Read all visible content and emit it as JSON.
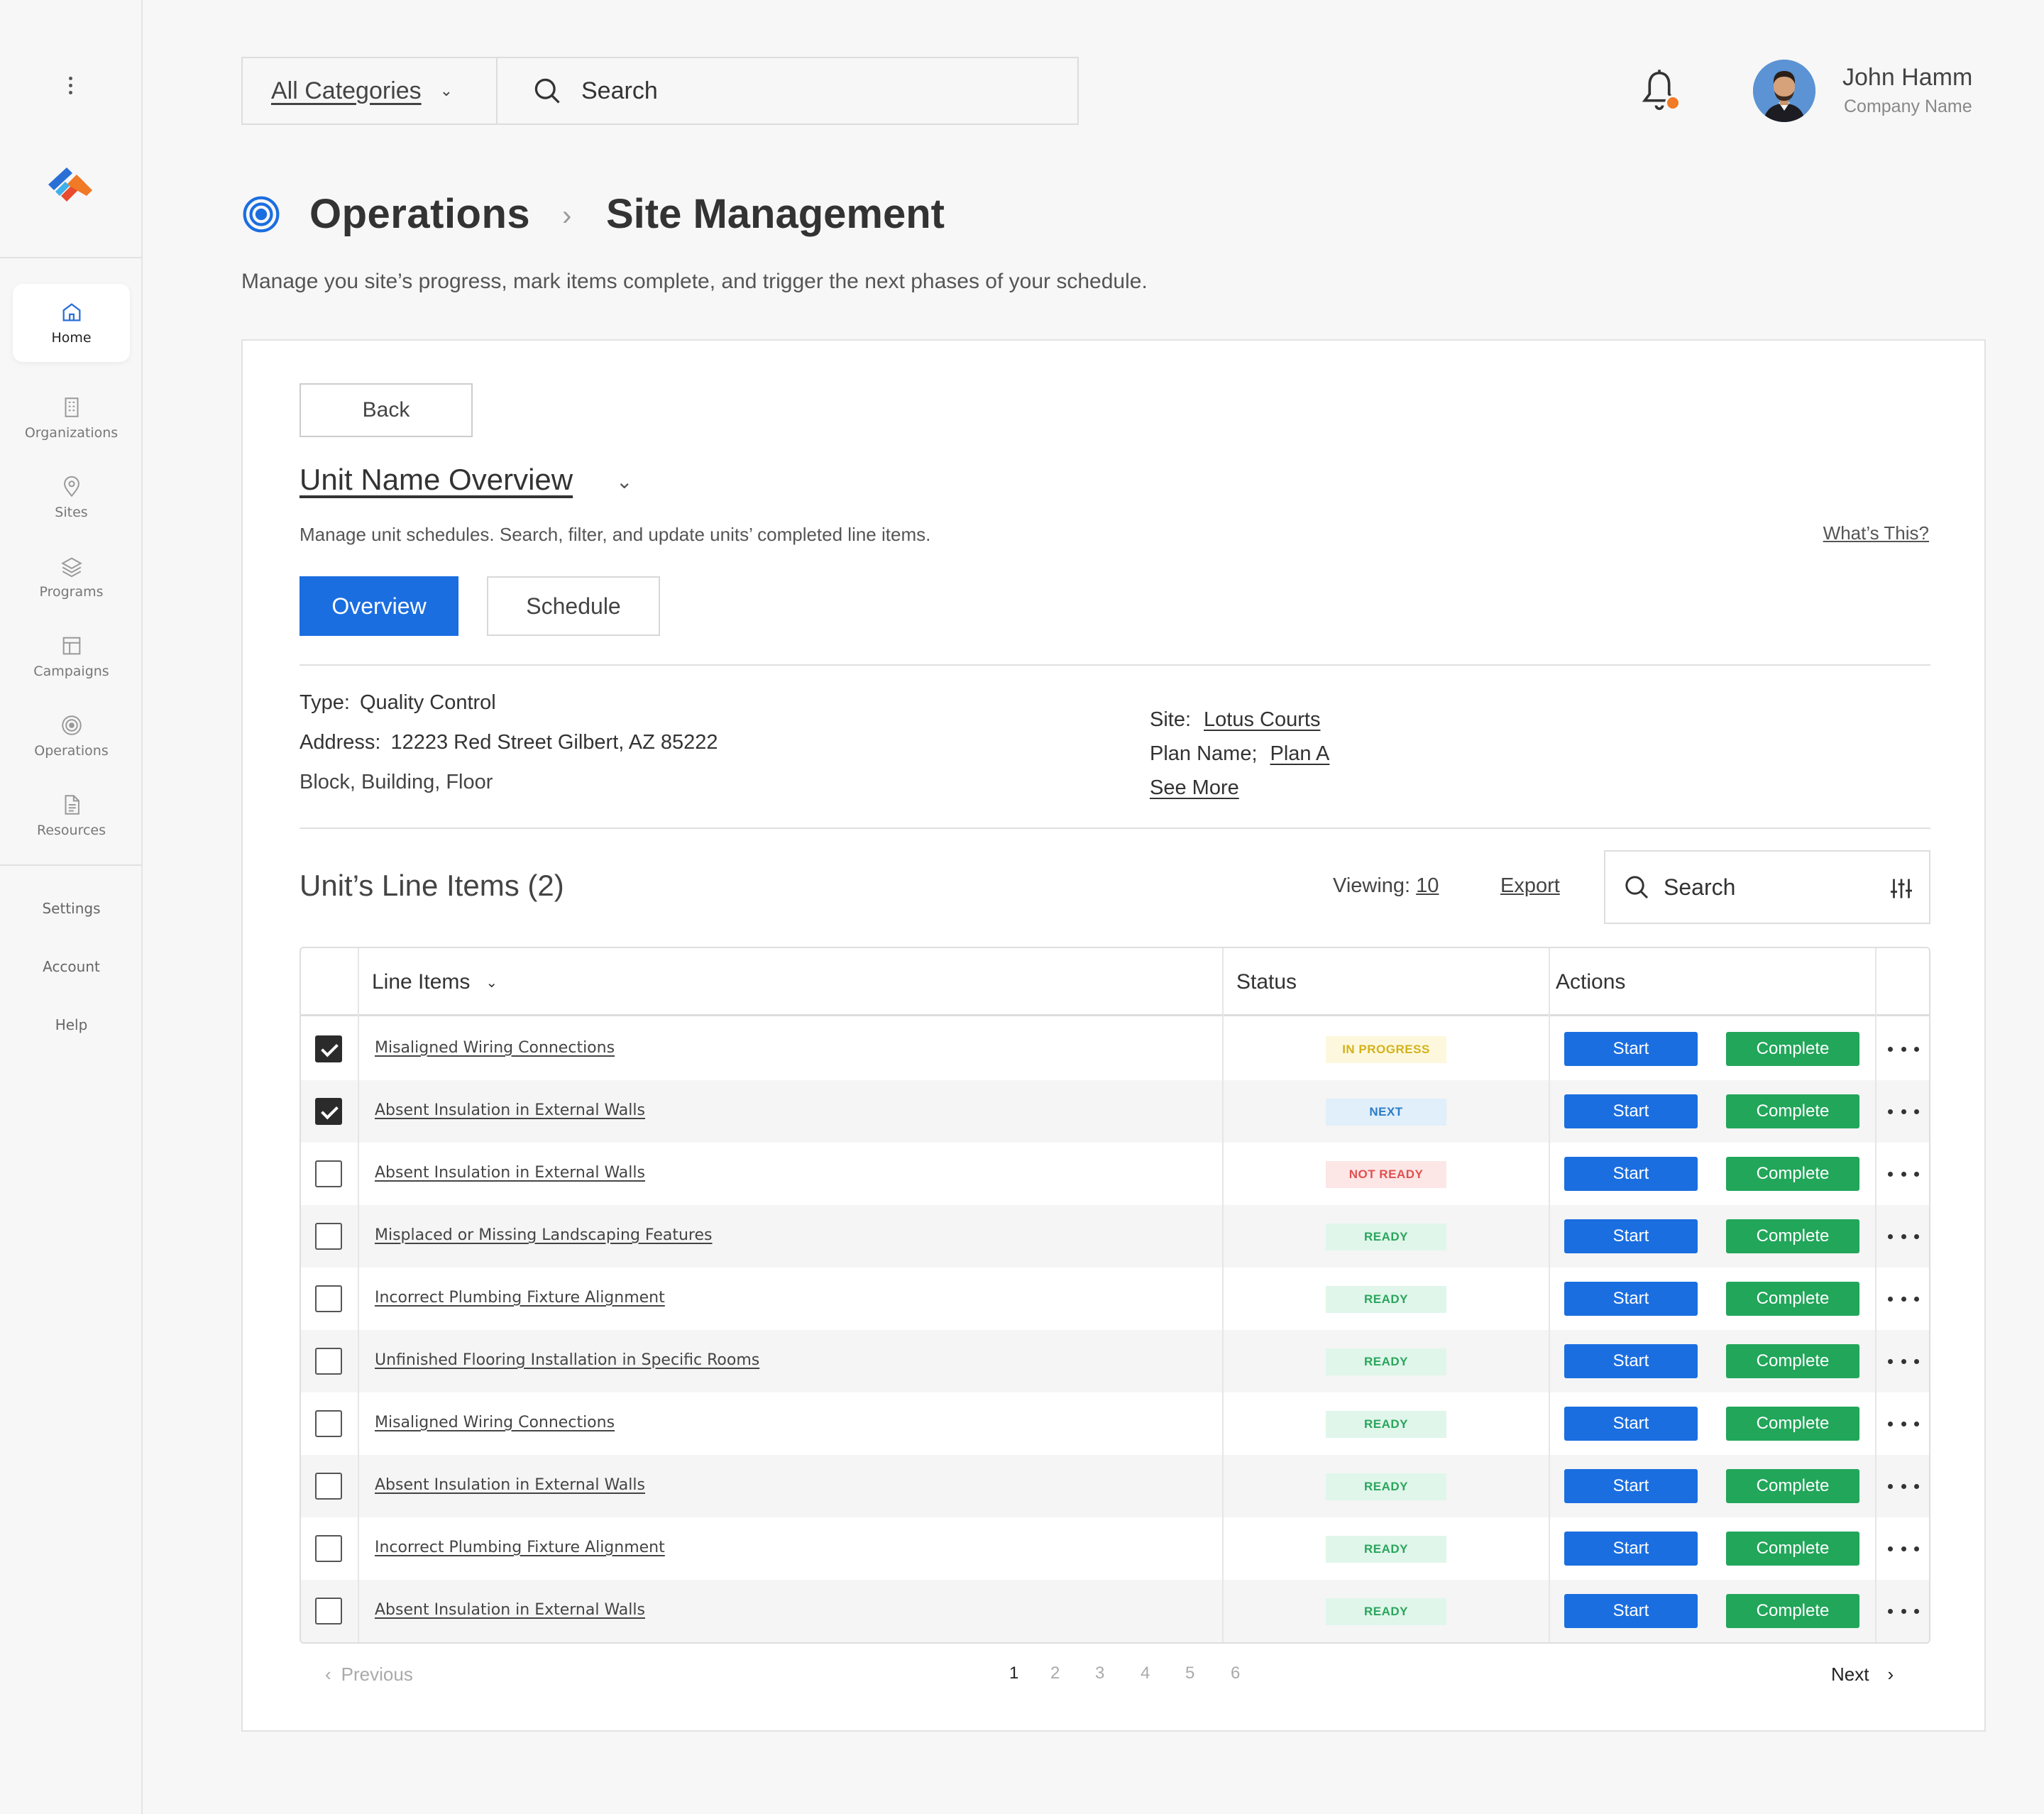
{
  "search_bar": {
    "category_label": "All Categories",
    "placeholder": "Search"
  },
  "user": {
    "name": "John Hamm",
    "company": "Company Name"
  },
  "sidebar": {
    "items": [
      {
        "label": "Home",
        "icon": "home-icon"
      },
      {
        "label": "Organizations",
        "icon": "building-icon"
      },
      {
        "label": "Sites",
        "icon": "location-pin-icon"
      },
      {
        "label": "Programs",
        "icon": "layers-icon"
      },
      {
        "label": "Campaigns",
        "icon": "layout-icon"
      },
      {
        "label": "Operations",
        "icon": "target-icon"
      },
      {
        "label": "Resources",
        "icon": "document-icon"
      }
    ],
    "links": [
      "Settings",
      "Account",
      "Help"
    ]
  },
  "breadcrumb": {
    "section": "Operations",
    "page": "Site Management",
    "separator": "›"
  },
  "page_description": "Manage you site’s progress, mark items complete, and trigger the next phases of your schedule.",
  "card": {
    "back_label": "Back",
    "unit_title": "Unit Name Overview",
    "unit_description": "Manage unit schedules. Search, filter, and update units’ completed line items.",
    "whats_this": "What’s This?",
    "tabs": {
      "overview": "Overview",
      "schedule": "Schedule"
    },
    "details": {
      "type_label": "Type:",
      "type_value": "Quality Control",
      "address_label": "Address:",
      "address_value": "12223 Red Street Gilbert, AZ 85222",
      "location_text": "Block, Building, Floor",
      "site_label": "Site:",
      "site_value": "Lotus Courts",
      "plan_label": "Plan Name;",
      "plan_value": "Plan A",
      "see_more": "See More"
    },
    "line_items_title": "Unit’s Line Items (2)",
    "viewing_label": "Viewing:",
    "viewing_value": "10",
    "export_label": "Export",
    "table_search_placeholder": "Search"
  },
  "table": {
    "headers": {
      "items": "Line Items",
      "status": "Status",
      "actions": "Actions"
    },
    "start_label": "Start",
    "complete_label": "Complete",
    "rows": [
      {
        "name": "Misaligned Wiring Connections",
        "status": "IN PROGRESS",
        "status_key": "progress",
        "checked": true
      },
      {
        "name": "Absent Insulation in External Walls",
        "status": "NEXT",
        "status_key": "next",
        "checked": true
      },
      {
        "name": "Absent Insulation in External Walls",
        "status": "NOT READY",
        "status_key": "notready",
        "checked": false
      },
      {
        "name": "Misplaced or Missing Landscaping Features",
        "status": "READY",
        "status_key": "ready",
        "checked": false
      },
      {
        "name": "Incorrect Plumbing Fixture Alignment",
        "status": "READY",
        "status_key": "ready",
        "checked": false
      },
      {
        "name": "Unfinished Flooring Installation in Specific Rooms",
        "status": "READY",
        "status_key": "ready",
        "checked": false
      },
      {
        "name": "Misaligned Wiring Connections",
        "status": "READY",
        "status_key": "ready",
        "checked": false
      },
      {
        "name": "Absent Insulation in External Walls",
        "status": "READY",
        "status_key": "ready",
        "checked": false
      },
      {
        "name": "Incorrect Plumbing Fixture Alignment",
        "status": "READY",
        "status_key": "ready",
        "checked": false
      },
      {
        "name": "Absent Insulation in External Walls",
        "status": "READY",
        "status_key": "ready",
        "checked": false
      }
    ]
  },
  "pagination": {
    "previous": "Previous",
    "next": "Next",
    "pages": [
      "1",
      "2",
      "3",
      "4",
      "5",
      "6"
    ],
    "current": "1"
  },
  "colors": {
    "primary": "#1a6ee0",
    "success": "#22a65a",
    "notification": "#f07a26"
  }
}
